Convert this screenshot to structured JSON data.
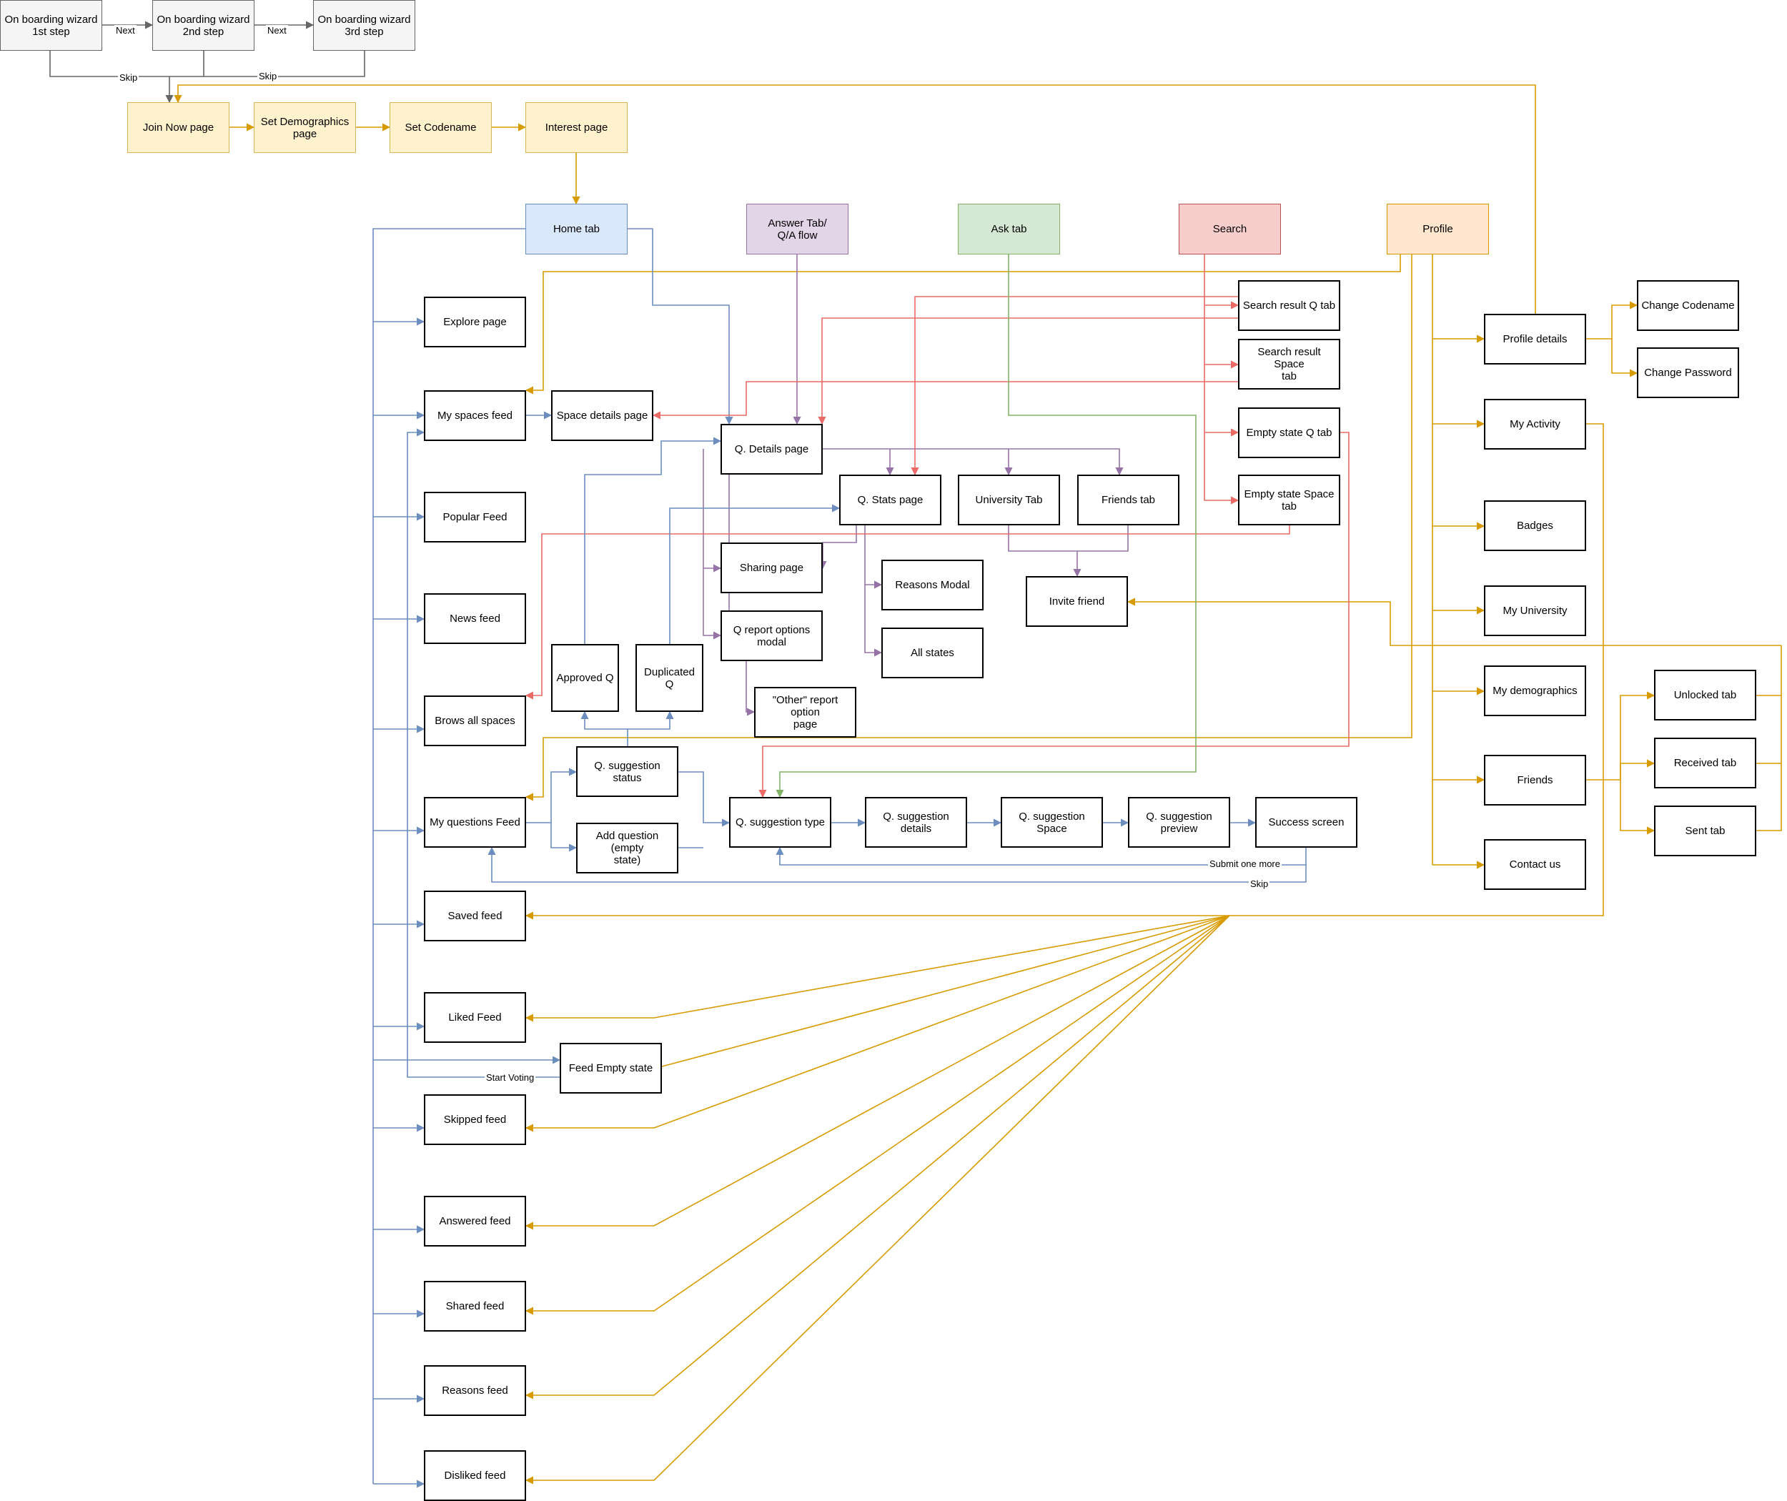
{
  "colors": {
    "gray": "#666666",
    "orange": "#d79b00",
    "blue": "#6c8ebf",
    "purple": "#9673a6",
    "red": "#ea6b66",
    "green": "#82b366"
  },
  "fills": {
    "gray": "#f5f5f5",
    "yellow": "#fff2cc",
    "yellowStroke": "#d6b656",
    "blue": "#dae8fc",
    "blueStroke": "#6c8ebf",
    "purple": "#e1d5e7",
    "purpleStroke": "#9673a6",
    "green": "#d5e8d4",
    "greenStroke": "#82b366",
    "red": "#f8cecc",
    "redStroke": "#b85450",
    "orange": "#ffe6cc",
    "orangeStroke": "#d79b00"
  },
  "nodes": {
    "ob1": "On boarding wizard\n1st step",
    "ob2": "On boarding wizard\n2nd step",
    "ob3": "On boarding wizard\n3rd step",
    "join": "Join Now page",
    "demo": "Set Demographics\npage",
    "codename": "Set Codename",
    "interest": "Interest page",
    "home": "Home tab",
    "answer": "Answer Tab/\nQ/A flow",
    "ask": "Ask tab",
    "search": "Search",
    "profile": "Profile",
    "explore": "Explore page",
    "myspaces": "My spaces feed",
    "spacedetails": "Space details page",
    "qdetails": "Q. Details page",
    "qstats": "Q. Stats page",
    "univtab": "University Tab",
    "friendstab": "Friends tab",
    "srq": "Search result Q tab",
    "srs": "Search result Space\ntab",
    "esq": "Empty state Q tab",
    "ess": "Empty state Space\ntab",
    "popular": "Popular Feed",
    "sharing": "Sharing page",
    "reasonsmodal": "Reasons Modal",
    "invite": "Invite friend",
    "news": "News feed",
    "qreport": "Q report options\nmodal",
    "allstates": "All states",
    "approved": "Approved Q",
    "duplicated": "Duplicated Q",
    "browse": "Brows all spaces",
    "otherreport": "\"Other\" report option\npage",
    "qsugstatus": "Q. suggestion status",
    "myquestions": "My questions Feed",
    "addq": "Add question (empty\nstate)",
    "qsugtype": "Q. suggestion type",
    "qsugdetails": "Q. suggestion details",
    "qsugspace": "Q. suggestion Space",
    "qsugpreview": "Q. suggestion\npreview",
    "success": "Success screen",
    "saved": "Saved feed",
    "liked": "Liked Feed",
    "feedempty": "Feed Empty state",
    "skipped": "Skipped feed",
    "answered": "Answered feed",
    "shared": "Shared feed",
    "reasonsfeed": "Reasons feed",
    "disliked": "Disliked feed",
    "profiledetails": "Profile details",
    "changecodename": "Change Codename",
    "changepassword": "Change Password",
    "myactivity": "My Activity",
    "badges": "Badges",
    "myuniversity": "My University",
    "mydemographics": "My demographics",
    "friends": "Friends",
    "contact": "Contact us",
    "unlocked": "Unlocked tab",
    "received": "Received tab",
    "sent": "Sent tab"
  },
  "edge_labels": {
    "next1": "Next",
    "next2": "Next",
    "skip1": "Skip",
    "skip2": "Skip",
    "submit_more": "Submit one more",
    "skip3": "Skip",
    "start_voting": "Start Voting"
  }
}
